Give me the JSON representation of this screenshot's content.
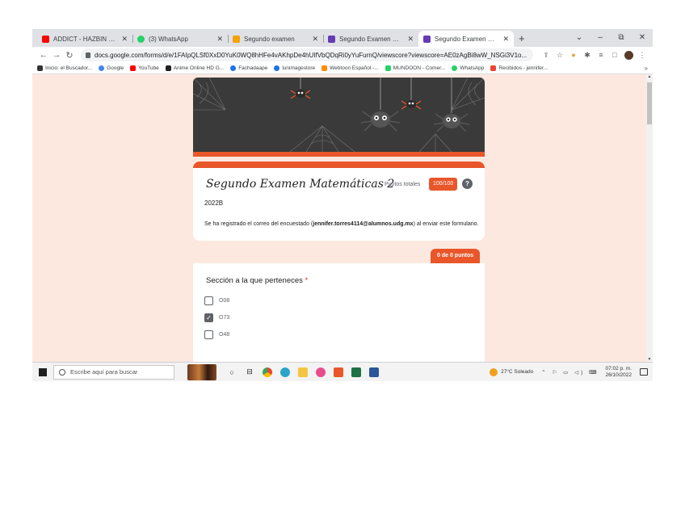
{
  "browser": {
    "tabs": [
      {
        "title": "ADDICT - HAZBIN HOTEL (C",
        "color": "#ff0000",
        "active": false
      },
      {
        "title": "(3) WhatsApp",
        "color": "#25d366",
        "active": false
      },
      {
        "title": "Segundo examen",
        "color": "#f4a300",
        "active": false
      },
      {
        "title": "Segundo Examen Matemátic",
        "color": "#673ab7",
        "active": false
      },
      {
        "title": "Segundo Examen Matemáti",
        "color": "#673ab7",
        "active": true
      }
    ],
    "new_tab": "+",
    "window_controls": [
      "⌄",
      "–",
      "⧉",
      "✕"
    ],
    "url": "docs.google.com/forms/d/e/1FAIpQLSf0XxD0YuK0WQ8hHFe4vAKhpDe4hUIfVbQDqRi0yYuFurnQ/viewscore?viewscore=AE0zAgBi8wW_NSGi3V1o...",
    "toolbar_icons": [
      "share-icon",
      "star-icon",
      "extension-cookie-icon",
      "extensions-icon",
      "reading-list-icon",
      "sidebar-icon",
      "profile-avatar-icon",
      "more-menu-icon"
    ],
    "bookmarks": [
      {
        "label": "Inicio: el Buscador...",
        "color": "#333333"
      },
      {
        "label": "Google",
        "color": "#4285f4"
      },
      {
        "label": "YouTube",
        "color": "#ff0000"
      },
      {
        "label": "Anime Online HD G...",
        "color": "#222222"
      },
      {
        "label": "Fachadaape",
        "color": "#1a73e8"
      },
      {
        "label": "lunimagestore",
        "color": "#1a73e8"
      },
      {
        "label": "Webtoon Español -...",
        "color": "#ff8c00"
      },
      {
        "label": "MUNDOON - Comer...",
        "color": "#25d366"
      },
      {
        "label": "WhatsApp",
        "color": "#25d366"
      },
      {
        "label": "Recibidos - jennifer...",
        "color": "#ea4335"
      }
    ],
    "bookmarks_more": "»"
  },
  "form": {
    "title": "Segundo Examen Matemáticas 2",
    "points_label": "Puntos totales",
    "points_value": "100/100",
    "help": "?",
    "subtitle": "2022B",
    "description_prefix": "Se ha registrado el correo del encuestado (",
    "email": "jennifer.torres4114@alumnos.udg.mx",
    "description_suffix": ") al enviar este formulario.",
    "accent_color": "#e8562a"
  },
  "question": {
    "score_tab": "0 de 0 puntos",
    "title": "Sección a la que perteneces",
    "required_mark": "*",
    "options": [
      {
        "label": "O08",
        "checked": false
      },
      {
        "label": "O73",
        "checked": true
      },
      {
        "label": "O48",
        "checked": false
      }
    ]
  },
  "taskbar": {
    "search_placeholder": "Escribe aquí para buscar",
    "weather": "27°C Soleado",
    "tray_icons": "⌃ ⚐ ▭ ◁) ⌨",
    "time": "07:02 p. m.",
    "date": "26/10/2022"
  }
}
